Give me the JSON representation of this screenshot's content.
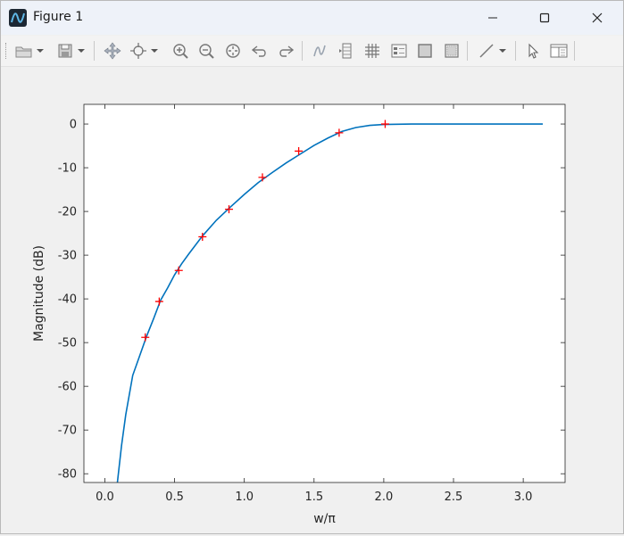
{
  "window": {
    "title": "Figure 1"
  },
  "titlebar_buttons": [
    {
      "name": "minimize-button",
      "icon": "minimize-icon"
    },
    {
      "name": "maximize-button",
      "icon": "maximize-icon"
    },
    {
      "name": "close-button",
      "icon": "close-icon"
    }
  ],
  "toolbar": {
    "items": [
      {
        "name": "open-file-button",
        "icon": "folder-icon",
        "dropdown": true
      },
      {
        "name": "save-button",
        "icon": "save-icon",
        "dropdown": true
      },
      {
        "name": "pan-button",
        "icon": "pan-icon"
      },
      {
        "name": "data-tips-button",
        "icon": "data-tips-icon",
        "dropdown": true
      },
      {
        "name": "zoom-in-button",
        "icon": "zoom-in-icon"
      },
      {
        "name": "zoom-out-button",
        "icon": "zoom-out-icon"
      },
      {
        "name": "restore-view-button",
        "icon": "restore-view-icon"
      },
      {
        "name": "undo-button",
        "icon": "undo-icon"
      },
      {
        "name": "redo-button",
        "icon": "redo-icon"
      },
      {
        "name": "brush-button",
        "icon": "brush-icon"
      },
      {
        "name": "insert-colorbar-button",
        "icon": "colorbar-icon"
      },
      {
        "name": "grid-button",
        "icon": "grid-icon"
      },
      {
        "name": "insert-legend-button",
        "icon": "legend-icon"
      },
      {
        "name": "box-button",
        "icon": "box-icon"
      },
      {
        "name": "hide-axes-button",
        "icon": "hide-axes-icon"
      },
      {
        "name": "insert-line-button",
        "icon": "line-icon",
        "dropdown": true
      },
      {
        "name": "edit-plot-button",
        "icon": "pointer-icon"
      },
      {
        "name": "property-inspector-button",
        "icon": "property-inspector-icon"
      }
    ]
  },
  "chart_data": {
    "type": "line",
    "title": "",
    "xlabel": "w/π",
    "ylabel": "Magnitude (dB)",
    "xlim": [
      -0.15,
      3.3
    ],
    "ylim": [
      -82,
      4.5
    ],
    "xticks": [
      0.0,
      0.5,
      1.0,
      1.5,
      2.0,
      2.5,
      3.0
    ],
    "xtick_labels": [
      "0.0",
      "0.5",
      "1.0",
      "1.5",
      "2.0",
      "2.5",
      "3.0"
    ],
    "yticks": [
      0,
      -10,
      -20,
      -30,
      -40,
      -50,
      -60,
      -70,
      -80
    ],
    "ytick_labels": [
      "0",
      "-10",
      "-20",
      "-30",
      "-40",
      "-50",
      "-60",
      "-70",
      "-80"
    ],
    "grid": false,
    "series": [
      {
        "kind": "line",
        "color": "#0072bd",
        "x": [
          0.09,
          0.12,
          0.15,
          0.2,
          0.25,
          0.3,
          0.35,
          0.4,
          0.45,
          0.5,
          0.55,
          0.6,
          0.7,
          0.8,
          0.9,
          1.0,
          1.1,
          1.2,
          1.3,
          1.4,
          1.5,
          1.6,
          1.7,
          1.8,
          1.9,
          2.0,
          2.2,
          2.4,
          2.6,
          2.8,
          3.0,
          3.14
        ],
        "y": [
          -82,
          -73.5,
          -66.5,
          -57.5,
          -53,
          -48.5,
          -44.5,
          -40.3,
          -37.5,
          -34.5,
          -32,
          -29.8,
          -25.6,
          -22,
          -19,
          -16.1,
          -13.4,
          -11.1,
          -8.9,
          -6.9,
          -4.9,
          -3.2,
          -1.7,
          -0.8,
          -0.3,
          -0.1,
          0,
          0,
          0,
          0,
          0,
          0
        ]
      },
      {
        "kind": "markers",
        "marker": "+",
        "color": "#ff0000",
        "x": [
          0.29,
          0.39,
          0.53,
          0.7,
          0.89,
          1.13,
          1.39,
          1.68,
          2.01
        ],
        "y": [
          -48.8,
          -40.6,
          -33.5,
          -25.8,
          -19.5,
          -12.2,
          -6.2,
          -2.0,
          0
        ]
      }
    ]
  }
}
